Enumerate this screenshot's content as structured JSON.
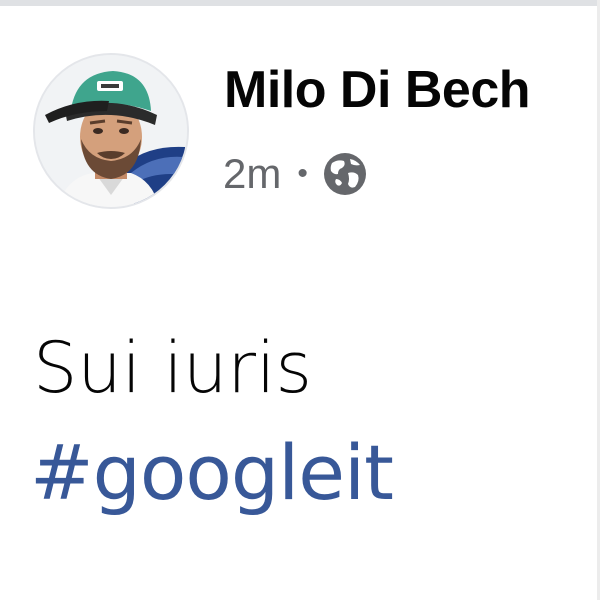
{
  "post": {
    "author_name": "Milo Di Bech",
    "timestamp": "2m",
    "separator": "•",
    "privacy_icon": "globe-icon",
    "text": "Sui iuris",
    "hashtag": "#googleit"
  },
  "colors": {
    "name": "#050505",
    "meta": "#65676b",
    "hashtag": "#385898",
    "background": "#ffffff"
  }
}
